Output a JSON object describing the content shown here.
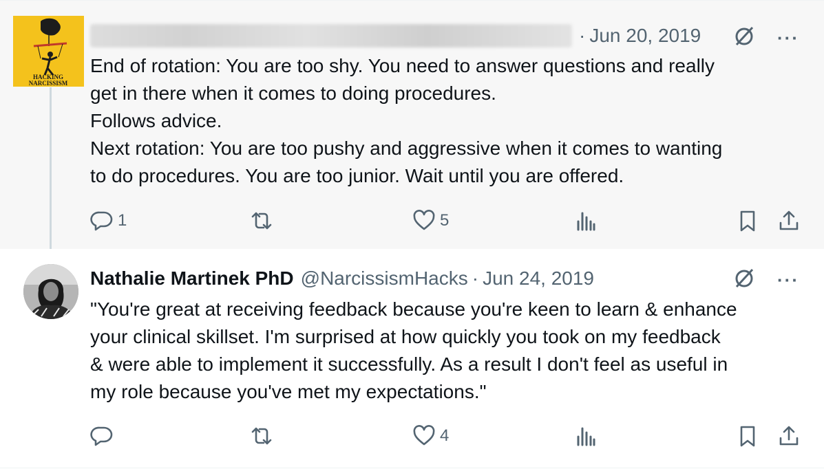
{
  "colors": {
    "background": "#ffffff",
    "highlight_bg": "#f7f7f7",
    "text": "#0f1419",
    "secondary": "#536471",
    "thread_line": "#cfd9de"
  },
  "parent_tweet": {
    "avatar": {
      "icon": "hacking-narcissism-logo",
      "text_line1": "HACKING",
      "text_line2": "NARCISSISM"
    },
    "separator": "·",
    "date": "Jun 20, 2019",
    "text_lines": [
      "End of rotation: You are too shy.  You need to answer questions and really",
      "get in there when it comes to doing procedures.",
      "Follows advice.",
      "Next rotation: You are too pushy and aggressive when it comes to wanting",
      "to do procedures. You are too junior. Wait until you are offered."
    ],
    "more_label": "···",
    "actions": {
      "replies": "1",
      "retweets": "",
      "likes": "5",
      "views": ""
    }
  },
  "reply_tweet": {
    "name": "Nathalie Martinek PhD",
    "handle": "@NarcissismHacks",
    "separator": "·",
    "date": "Jun 24, 2019",
    "text_lines": [
      "\"You're great at receiving feedback because you're keen to learn & enhance",
      "your clinical skillset. I'm surprised at how quickly you took on my feedback",
      "& were able to implement it successfully. As a result I don't feel as useful in",
      "my role because you've met my expectations.\""
    ],
    "more_label": "···",
    "actions": {
      "replies": "",
      "retweets": "",
      "likes": "4",
      "views": ""
    }
  }
}
